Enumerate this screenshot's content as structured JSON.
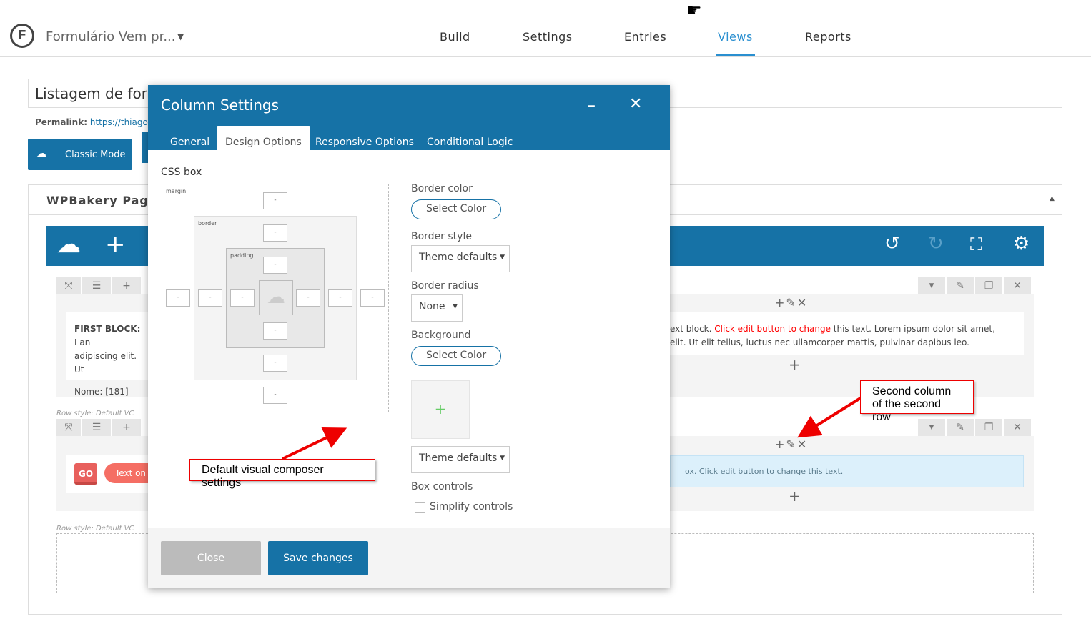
{
  "header": {
    "form_title": "Formulário Vem pr...",
    "nav": [
      {
        "label": "Build"
      },
      {
        "label": "Settings"
      },
      {
        "label": "Entries"
      },
      {
        "label": "Views",
        "active": true
      },
      {
        "label": "Reports"
      }
    ]
  },
  "page": {
    "title_value": "Listagem de forr",
    "permalink_label": "Permalink:",
    "permalink_url": "https://thiagova",
    "classic_mode": "Classic Mode",
    "panel_title": "WPBakery Page I"
  },
  "rows": [
    {
      "text_bold": "FIRST BLOCK:",
      "text_line1": " I an",
      "text_line2": "adipiscing elit. Ut",
      "text_line3": "Nome: [181]",
      "right_pre": "ext block. ",
      "right_red": "Click edit button to change",
      "right_post": " this text. Lorem ipsum dolor sit amet,",
      "right_line2": "elit. Ut elit tellus, luctus nec ullamcorper mattis, pulvinar dapibus leo.",
      "style_label": "Row style: Default VC"
    },
    {
      "go": "GO",
      "text_on": "Text on",
      "right_text": "ox. Click edit button to change this text.",
      "style_label": "Row style: Default VC"
    }
  ],
  "modal": {
    "title": "Column Settings",
    "tabs": [
      "General",
      "Design Options",
      "Responsive Options",
      "Conditional Logic"
    ],
    "active_tab": "Design Options",
    "css_box_label": "CSS box",
    "margin": "margin",
    "border": "border",
    "padding": "padding",
    "box_value": "-",
    "border_color_label": "Border color",
    "select_color": "Select Color",
    "border_style_label": "Border style",
    "border_style_value": "Theme defaults",
    "border_radius_label": "Border radius",
    "border_radius_value": "None",
    "background_label": "Background",
    "background_style_value": "Theme defaults",
    "box_controls_label": "Box controls",
    "simplify_controls": "Simplify controls",
    "simplify_checked": false,
    "close": "Close",
    "save": "Save changes"
  },
  "annotations": {
    "default_settings": "Default visual composer settings",
    "second_col_1": "Second column",
    "second_col_2": "of the second row"
  },
  "colors": {
    "brand_blue": "#1672a6",
    "active_nav": "#2a8fd0",
    "annotation_red": "#e00000"
  }
}
